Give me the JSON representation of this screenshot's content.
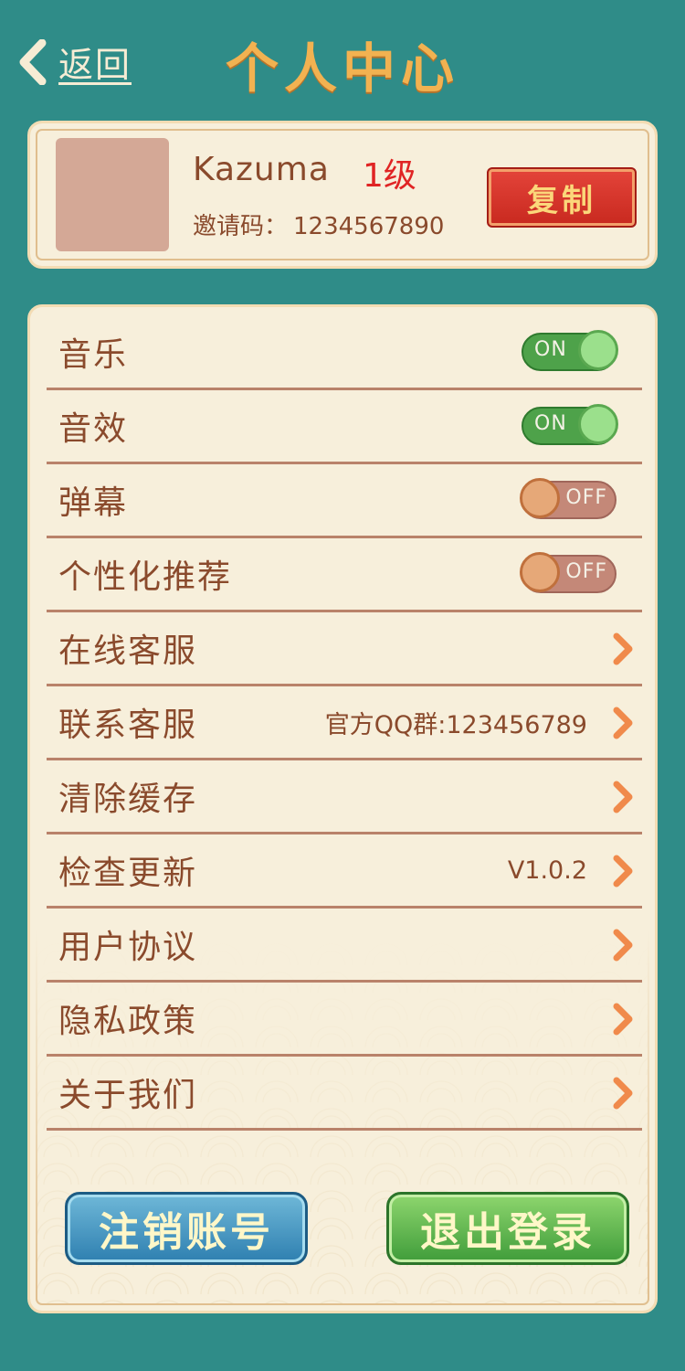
{
  "header": {
    "back_label": "返回",
    "title": "个人中心"
  },
  "profile": {
    "username": "Kazuma",
    "level": "1级",
    "invite_label": "邀请码：",
    "invite_code": "1234567890",
    "copy_label": "复制"
  },
  "settings": {
    "toggles": [
      {
        "label": "音乐",
        "state": "ON"
      },
      {
        "label": "音效",
        "state": "ON"
      },
      {
        "label": "弹幕",
        "state": "OFF"
      },
      {
        "label": "个性化推荐",
        "state": "OFF"
      }
    ],
    "links": [
      {
        "label": "在线客服",
        "value": ""
      },
      {
        "label": "联系客服",
        "value": "官方QQ群:123456789"
      },
      {
        "label": "清除缓存",
        "value": ""
      },
      {
        "label": "检查更新",
        "value": "V1.0.2"
      },
      {
        "label": "用户协议",
        "value": ""
      },
      {
        "label": "隐私政策",
        "value": ""
      },
      {
        "label": "关于我们",
        "value": ""
      }
    ]
  },
  "buttons": {
    "delete_account": "注销账号",
    "logout": "退出登录"
  },
  "colors": {
    "background": "#2f8c88",
    "title": "#f2b251",
    "text_brown": "#8a4a2c",
    "level_red": "#e02424",
    "toggle_on": "#4ea24a",
    "toggle_off": "#c48878"
  }
}
